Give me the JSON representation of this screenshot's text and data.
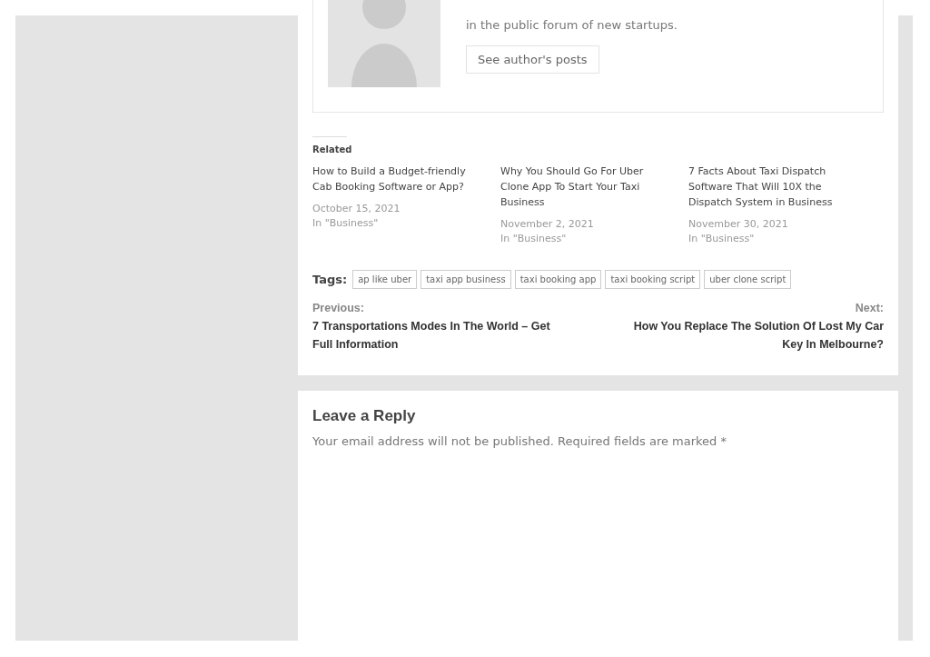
{
  "author_box": {
    "bio_end": "in the public forum of new startups.",
    "posts_button": "See author's posts"
  },
  "related": {
    "heading": "Related",
    "items": [
      {
        "title": "How to Build a Budget-friendly Cab Booking Software or App?",
        "date": "October 15, 2021",
        "category": "In \"Business\""
      },
      {
        "title": "Why You Should Go For Uber Clone App To Start Your Taxi Business",
        "date": "November 2, 2021",
        "category": "In \"Business\""
      },
      {
        "title": "7 Facts About Taxi Dispatch Software That Will 10X the Dispatch System in Business",
        "date": "November 30, 2021",
        "category": "In \"Business\""
      }
    ]
  },
  "tags": {
    "label": "Tags:",
    "items": [
      "ap like uber",
      "taxi app business",
      "taxi booking app",
      "taxi booking script",
      "uber clone script"
    ]
  },
  "post_nav": {
    "previous": {
      "label": "Previous:",
      "title": "7 Transportations Modes In The World – Get Full Information"
    },
    "next": {
      "label": "Next:",
      "title": "How You Replace The Solution Of Lost My Car Key In Melbourne?"
    }
  },
  "reply": {
    "heading": "Leave a Reply",
    "note": "Your email address will not be published. Required fields are marked *"
  }
}
